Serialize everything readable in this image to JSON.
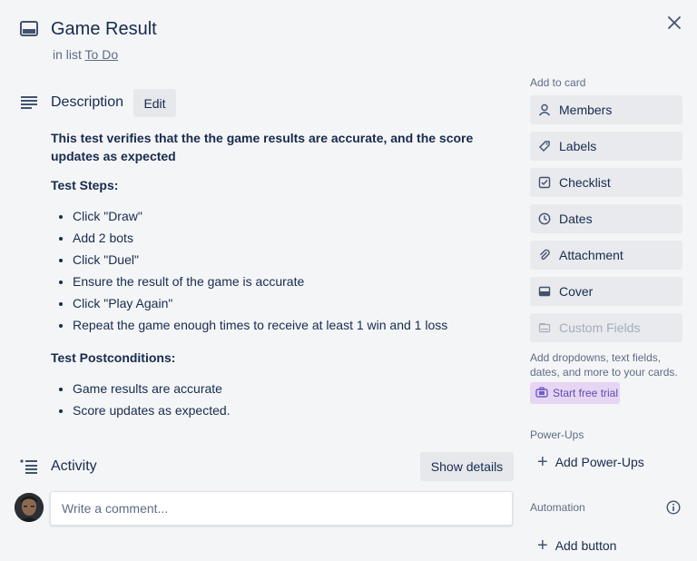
{
  "card": {
    "title": "Game Result",
    "in_list_prefix": "in list",
    "list_name": "To Do"
  },
  "description": {
    "heading": "Description",
    "edit_label": "Edit",
    "intro": "This test verifies that the the game results are accurate, and the score updates as expected",
    "steps_heading": "Test Steps:",
    "steps": [
      "Click \"Draw\"",
      "Add 2 bots",
      "Click \"Duel\"",
      "Ensure the result of the game is accurate",
      "Click \"Play Again\"",
      "Repeat the game enough times to receive at least 1 win and 1 loss"
    ],
    "post_heading": "Test Postconditions:",
    "postconditions": [
      "Game results are accurate",
      "Score updates as expected."
    ]
  },
  "activity": {
    "heading": "Activity",
    "show_details_label": "Show details",
    "comment_placeholder": "Write a comment..."
  },
  "sidebar": {
    "add_to_card_label": "Add to card",
    "buttons": [
      {
        "label": "Members",
        "icon": "person-icon"
      },
      {
        "label": "Labels",
        "icon": "tag-icon"
      },
      {
        "label": "Checklist",
        "icon": "checkbox-icon"
      },
      {
        "label": "Dates",
        "icon": "clock-icon"
      },
      {
        "label": "Attachment",
        "icon": "paperclip-icon"
      },
      {
        "label": "Cover",
        "icon": "cover-icon"
      },
      {
        "label": "Custom Fields",
        "icon": "custom-fields-icon"
      }
    ],
    "custom_fields_note": "Add dropdowns, text fields, dates, and more to your cards.",
    "trial_label": "Start free trial",
    "powerups_label": "Power-Ups",
    "add_powerups_label": "Add Power-Ups",
    "automation_label": "Automation",
    "add_button_label": "Add button"
  }
}
